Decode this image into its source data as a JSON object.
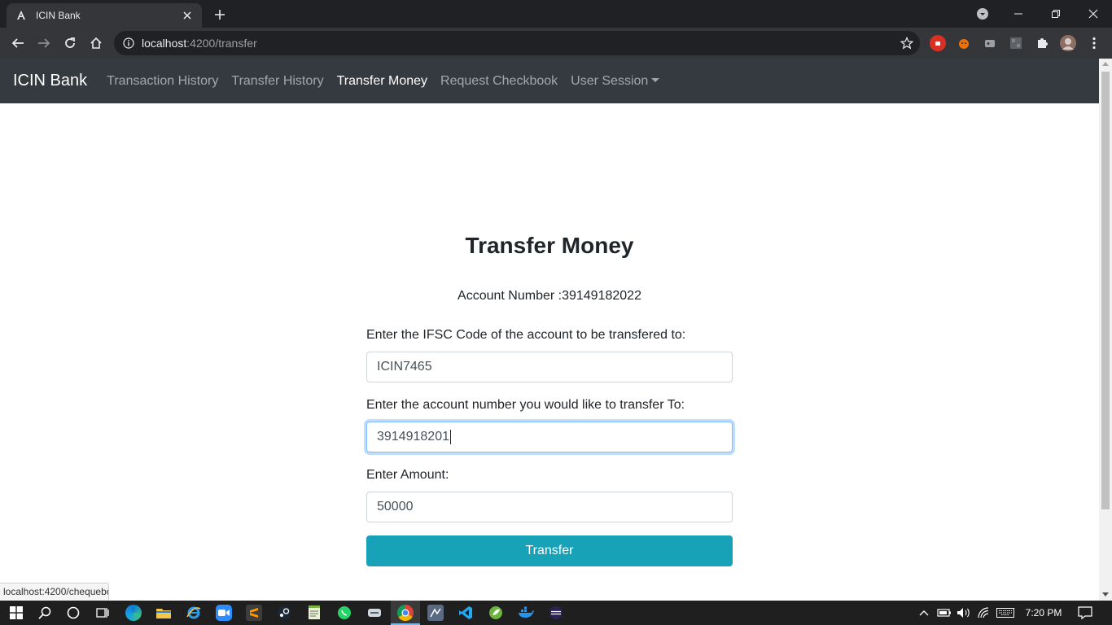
{
  "browser": {
    "tab_title": "ICIN Bank",
    "url_host": "localhost",
    "url_path": ":4200/transfer",
    "status_url": "localhost:4200/chequebook"
  },
  "navbar": {
    "brand": "ICIN Bank",
    "links": [
      {
        "label": "Transaction History",
        "active": false
      },
      {
        "label": "Transfer History",
        "active": false
      },
      {
        "label": "Transfer Money",
        "active": true
      },
      {
        "label": "Request Checkbook",
        "active": false
      },
      {
        "label": "User Session",
        "active": false
      }
    ]
  },
  "form": {
    "title": "Transfer Money",
    "account_line": "Account Number :39149182022",
    "ifsc_label": "Enter the IFSC Code of the account to be transfered to:",
    "ifsc_value": "ICIN7465",
    "account_label": "Enter the account number you would like to transfer To:",
    "account_value": "3914918201",
    "amount_label": "Enter Amount:",
    "amount_value": "50000",
    "submit_label": "Transfer"
  },
  "taskbar": {
    "clock": "7:20 PM"
  },
  "colors": {
    "navbar_bg": "#343a40",
    "button_bg": "#17a2b8",
    "chrome_dark": "#202124",
    "chrome_toolbar": "#35363a"
  }
}
